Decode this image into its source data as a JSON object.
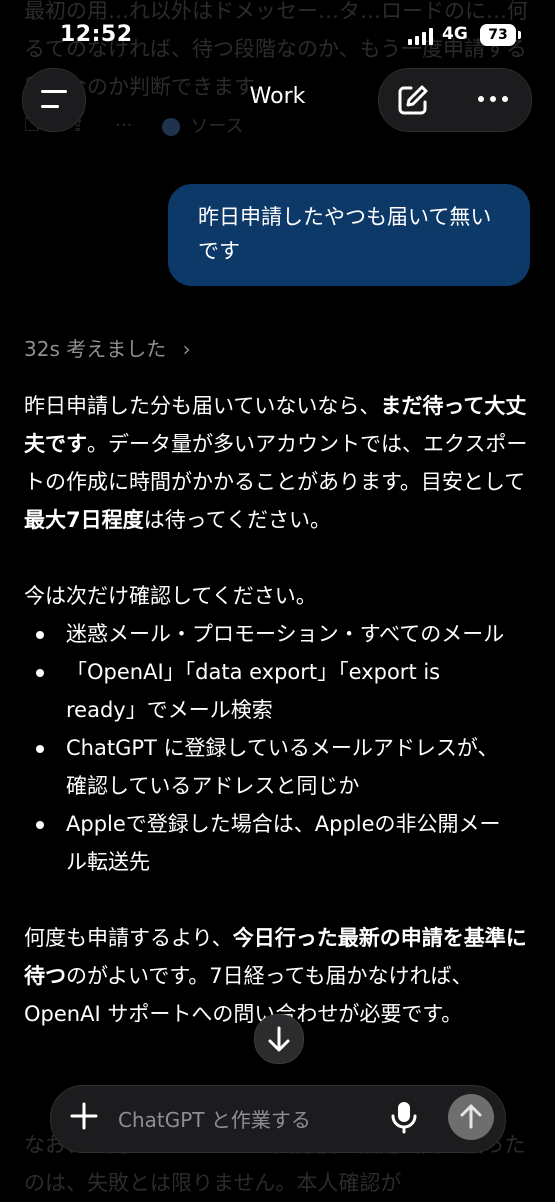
{
  "status_bar": {
    "time": "12:52",
    "network": "4G",
    "battery": "73"
  },
  "header": {
    "title": "Work"
  },
  "faded_top": {
    "text": "最初の用…れ以外はドメッセー…タ…ロードのに…何るてのなければ、待つ段階なのか、もう一度申請する段階なのか判断できます。",
    "source_label": "ソース"
  },
  "user_message": {
    "text": "昨日申請したやつも届いて無いです"
  },
  "thinking": {
    "label": "32s 考えました"
  },
  "answer": {
    "p1": {
      "a": "昨日申請した分も届いていないなら、",
      "b1": "まだ待って大丈夫です",
      "c": "。データ量が多いアカウントでは、エクスポートの作成に時間がかかることがあります。目安として",
      "b2": "最大7日程度",
      "d": "は待ってください。"
    },
    "p2": "今は次だけ確認してください。",
    "bullets": [
      "迷惑メール・プロモーション・すべてのメール",
      "「OpenAI」「data export」「export is ready」でメール検索",
      "ChatGPT に登録しているメールアドレスが、確認しているアドレスと同じか",
      "Appleで登録した場合は、Appleの非公開メール転送先"
    ],
    "p3": {
      "a": "何度も申請するより、",
      "b": "今日行った最新の申請を基準に待つ",
      "c": "のがよいです。7日経っても届かなければ、OpenAI サポートへの問い合わせが必要です。"
    }
  },
  "faded_bottom": {
    "text": "なお、一見にとスペース…大分後に設定画面へ戻ったのは、失敗とは限りません。本人確認が"
  },
  "composer": {
    "placeholder": "ChatGPT と作業する"
  },
  "icons": {
    "menu": "menu-icon",
    "compose": "compose-icon",
    "more": "more-icon",
    "chevron": "chevron-right-icon",
    "scroll_down": "arrow-down-icon",
    "plus": "plus-icon",
    "mic": "mic-icon",
    "send": "arrow-up-icon"
  },
  "colors": {
    "user_bubble": "#0d3968",
    "background": "#000000",
    "send_button": "#6e6e6e"
  }
}
